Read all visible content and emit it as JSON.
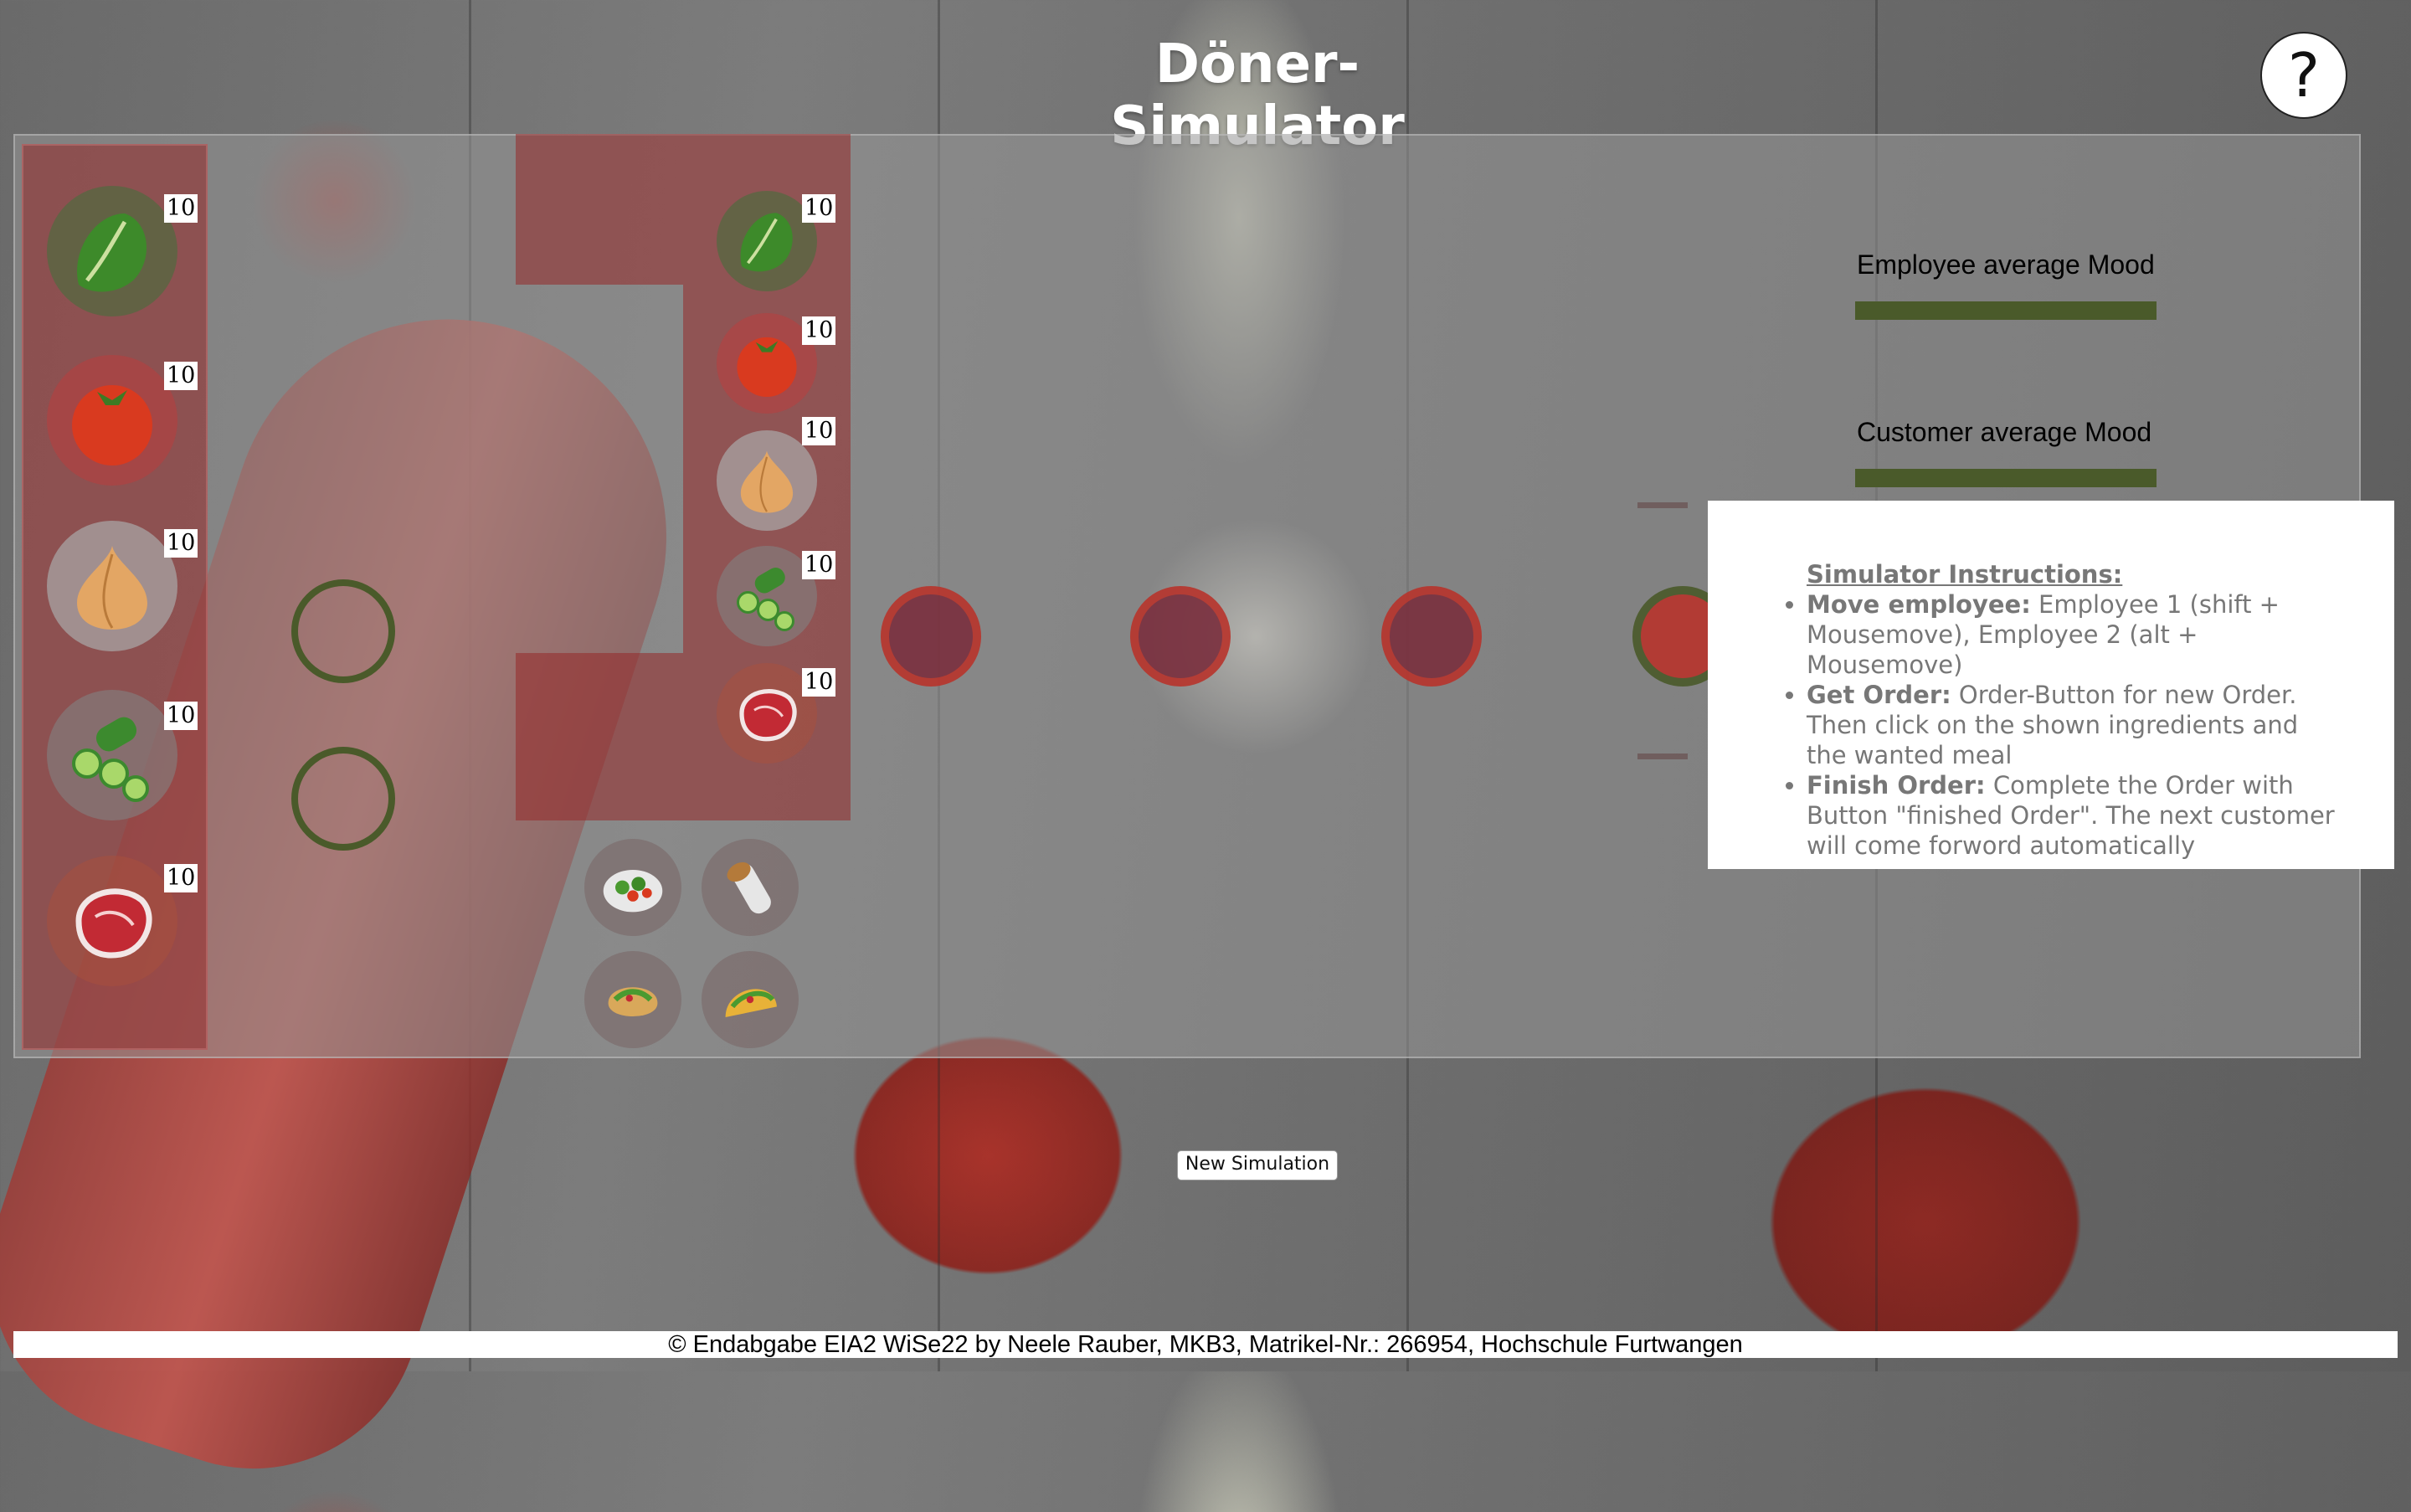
{
  "app": {
    "title": "Döner-Simulator",
    "help_label": "?"
  },
  "stock": {
    "items": [
      {
        "name": "lettuce",
        "count": "10",
        "color": "#2f6b22"
      },
      {
        "name": "tomato",
        "count": "10",
        "color": "#d43b22"
      },
      {
        "name": "onion",
        "count": "10",
        "color": "#d9a05a"
      },
      {
        "name": "cucumber",
        "count": "10",
        "color": "#4aa33a"
      },
      {
        "name": "meat",
        "count": "10",
        "color": "#b8262c"
      }
    ]
  },
  "counter": {
    "items": [
      {
        "name": "lettuce",
        "count": "10"
      },
      {
        "name": "tomato",
        "count": "10"
      },
      {
        "name": "onion",
        "count": "10"
      },
      {
        "name": "cucumber",
        "count": "10"
      },
      {
        "name": "meat",
        "count": "10"
      }
    ]
  },
  "meals": [
    "salad",
    "durum",
    "pita",
    "taco"
  ],
  "mood": {
    "employee_label": "Employee average Mood",
    "customer_label": "Customer average Mood",
    "bar_color": "#4a5a2a"
  },
  "instructions": {
    "heading": "Simulator Instructions:",
    "items": [
      {
        "title": "Move employee:",
        "text": " Employee 1 (shift + Mousemove), Employee 2 (alt + Mousemove)"
      },
      {
        "title": "Get Order:",
        "text": " Order-Button for new Order. Then click on the shown ingredients and the wanted meal"
      },
      {
        "title": "Finish Order:",
        "text": " Complete the Order with Button \"finished Order\". The next customer will come forword automatically"
      }
    ]
  },
  "buttons": {
    "new_simulation": "New Simulation"
  },
  "footer": {
    "text": "© Endabgabe EIA2 WiSe22 by Neele Rauber, MKB3, Matrikel-Nr.: 266954, Hochschule Furtwangen"
  }
}
